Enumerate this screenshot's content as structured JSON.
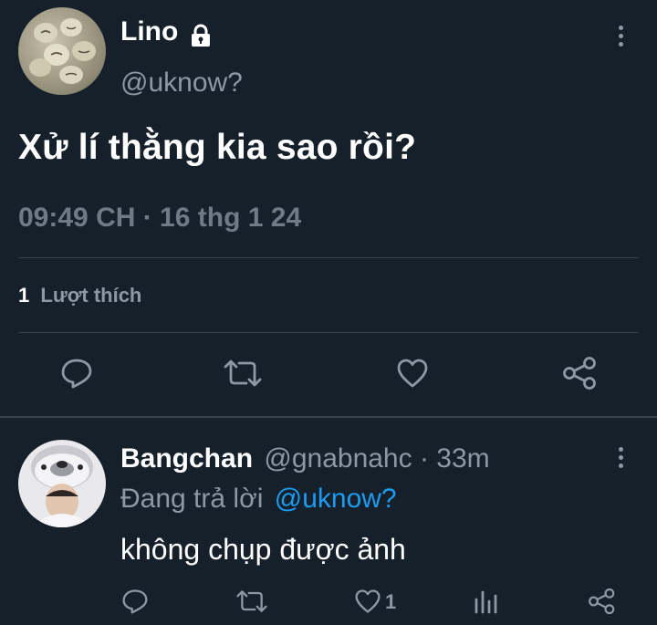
{
  "colors": {
    "background": "#15202b",
    "text": "#ffffff",
    "muted": "#8b98a5",
    "accent": "#1d9bf0",
    "divider": "#38444d"
  },
  "main_tweet": {
    "author_name": "Lino",
    "lock_icon": "lock-icon",
    "handle": "@uknow?",
    "text": "Xử lí thằng kia sao rồi?",
    "timestamp": "09:49 CH · 16 thg 1 24",
    "likes_count": "1",
    "likes_label": "Lượt thích",
    "actions": [
      "reply-icon",
      "retweet-icon",
      "like-icon",
      "share-icon"
    ]
  },
  "reply": {
    "author_name": "Bangchan",
    "handle": "@gnabnahc",
    "time": "· 33m",
    "replying_prefix": "Đang trả lời",
    "replying_to": "@uknow?",
    "text": "không chụp được ảnh",
    "like_count": "1",
    "actions": [
      "reply-icon",
      "retweet-icon",
      "like-icon",
      "analytics-icon",
      "share-icon"
    ]
  }
}
